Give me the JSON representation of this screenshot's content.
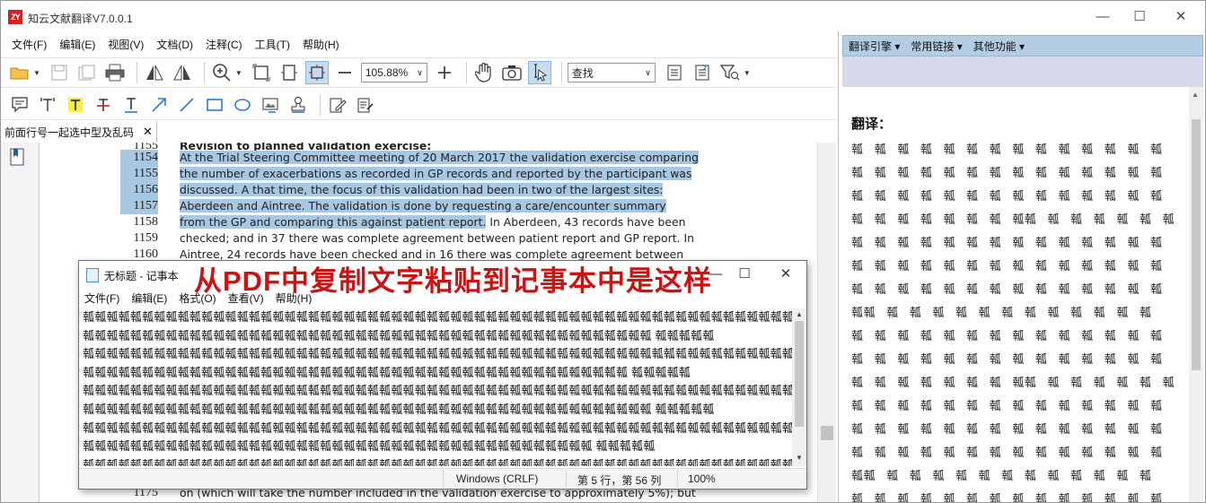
{
  "window": {
    "logo": "ZY",
    "title": "知云文献翻译V7.0.0.1",
    "minimize_label": "—",
    "maximize_label": "☐",
    "close_label": "✕"
  },
  "menu": {
    "items": [
      "文件(F)",
      "编辑(E)",
      "视图(V)",
      "文档(D)",
      "注释(C)",
      "工具(T)",
      "帮助(H)"
    ]
  },
  "toolbar": {
    "zoom_value": "105.88%",
    "search_value": "查找"
  },
  "tab": {
    "label": "前面行号一起选中型及乱码",
    "close_label": "✕"
  },
  "document": {
    "lines": [
      {
        "num": "1155",
        "text": "Revision to planned validation exercise:",
        "highlight": false,
        "bold": true
      },
      {
        "num": "1154",
        "text": "At the Trial Steering Committee meeting of 20 March 2017 the validation exercise comparing",
        "highlight": true
      },
      {
        "num": "1155",
        "text": "the number of exacerbations as recorded in GP records and reported by the participant was",
        "highlight": true
      },
      {
        "num": "1156",
        "text": "discussed. A that time, the focus of this validation had been in two of the largest sites:",
        "highlight": true
      },
      {
        "num": "1157",
        "text": "Aberdeen and Aintree.   The validation is done by requesting a care/encounter summary",
        "highlight": true
      },
      {
        "num": "1158",
        "text": "from the GP and comparing this against patient report.",
        "text_after": " In Aberdeen, 43 records have been",
        "highlight": "partial"
      },
      {
        "num": "1159",
        "text": "checked; and in 37 there was complete agreement between patient report and GP report.  In",
        "highlight": false
      },
      {
        "num": "1160",
        "text": "Aintree, 24 records have been checked and in 16 there was complete agreement between",
        "highlight": false
      }
    ],
    "bottom_line": {
      "num": "1175",
      "text": "on (which will take the number included in the validation exercise to approximately 5%); but"
    }
  },
  "right_panel": {
    "menu": [
      "翻译引擎 ▾",
      "常用链接 ▾",
      "其他功能 ▾"
    ],
    "title": "翻译：",
    "garbled_rows": [
      "瓡 瓡 瓡 瓡 瓡 瓡 瓡 瓡 瓡 瓡 瓡 瓡 瓡 瓡",
      "瓡 瓡 瓡 瓡 瓡 瓡 瓡 瓡 瓡 瓡 瓡 瓡 瓡 瓡",
      "瓡 瓡 瓡 瓡 瓡 瓡 瓡 瓡 瓡 瓡 瓡 瓡 瓡 瓡",
      "瓡 瓡 瓡 瓡 瓡 瓡 瓡 瓡瓡 瓡 瓡 瓡 瓡 瓡 瓡",
      "瓡 瓡 瓡 瓡 瓡 瓡 瓡 瓡 瓡 瓡 瓡 瓡 瓡 瓡",
      "瓡 瓡 瓡 瓡 瓡 瓡 瓡 瓡 瓡 瓡 瓡 瓡 瓡 瓡",
      "瓡 瓡 瓡 瓡 瓡 瓡 瓡 瓡 瓡 瓡 瓡 瓡 瓡 瓡",
      "瓡瓡 瓡 瓡 瓡 瓡 瓡 瓡 瓡 瓡 瓡 瓡 瓡 瓡",
      "瓡 瓡 瓡 瓡 瓡 瓡 瓡 瓡 瓡 瓡 瓡 瓡 瓡 瓡",
      "瓡 瓡 瓡 瓡 瓡 瓡 瓡 瓡 瓡 瓡 瓡 瓡 瓡 瓡",
      "瓡 瓡 瓡 瓡 瓡 瓡 瓡 瓡瓡 瓡 瓡 瓡 瓡 瓡 瓡",
      "瓡 瓡 瓡 瓡 瓡 瓡 瓡 瓡 瓡 瓡 瓡 瓡 瓡 瓡",
      "瓡 瓡 瓡 瓡 瓡 瓡 瓡 瓡 瓡 瓡 瓡 瓡 瓡 瓡",
      "瓡 瓡 瓡 瓡 瓡 瓡 瓡 瓡 瓡 瓡 瓡 瓡 瓡 瓡",
      "瓡瓡 瓡 瓡 瓡 瓡 瓡 瓡 瓡 瓡 瓡 瓡 瓡 瓡",
      "瓡 瓡 瓡 瓡 瓡 瓡 瓡 瓡 瓡 瓡 瓡 瓡 瓡 瓡"
    ]
  },
  "notepad": {
    "title": "无标题 - 记事本",
    "annotation": "从PDF中复制文字粘贴到记事本中是这样",
    "minimize_label": "—",
    "maximize_label": "☐",
    "close_label": "✕",
    "menu": [
      "文件(F)",
      "编辑(E)",
      "格式(O)",
      "查看(V)",
      "帮助(H)"
    ],
    "content_lines": [
      "瓡瓡瓡瓡瓡瓡瓡瓡瓡瓡瓡瓡瓡瓡瓡瓡瓡瓡瓡瓡瓡瓡瓡瓡瓡瓡瓡瓡瓡瓡瓡瓡瓡瓡瓡瓡瓡瓡瓡瓡瓡瓡瓡瓡瓡瓡瓡瓡瓡瓡瓡瓡瓡瓡瓡瓡瓡瓡瓡瓡",
      "瓡瓡瓡瓡瓡瓡瓡瓡瓡瓡瓡瓡瓡瓡瓡瓡瓡瓡瓡瓡瓡瓡瓡瓡瓡瓡瓡瓡瓡瓡瓡瓡瓡瓡瓡瓡瓡瓡瓡瓡瓡瓡瓡瓡瓡瓡瓡瓡 瓡瓡瓡瓡瓡",
      "瓡瓡瓡瓡瓡瓡瓡瓡瓡瓡瓡瓡瓡瓡瓡瓡瓡瓡瓡瓡瓡瓡瓡瓡瓡瓡瓡瓡瓡瓡瓡瓡瓡瓡瓡瓡瓡瓡瓡瓡瓡瓡瓡瓡瓡瓡瓡瓡瓡瓡瓡瓡瓡瓡瓡瓡瓡瓡瓡瓡",
      "瓡瓡瓡瓡瓡瓡瓡瓡瓡瓡瓡瓡瓡瓡瓡瓡瓡瓡瓡瓡瓡瓡瓡瓡瓡瓡瓡瓡瓡瓡瓡瓡瓡瓡瓡瓡瓡瓡瓡瓡瓡瓡瓡瓡瓡瓡 瓡瓡瓡瓡瓡",
      "瓡瓡瓡瓡瓡瓡瓡瓡瓡瓡瓡瓡瓡瓡瓡瓡瓡瓡瓡瓡瓡瓡瓡瓡瓡瓡瓡瓡瓡瓡瓡瓡瓡瓡瓡瓡瓡瓡瓡瓡瓡瓡瓡瓡瓡瓡瓡瓡瓡瓡瓡瓡瓡瓡瓡瓡瓡瓡瓡瓡",
      "瓡瓡瓡瓡瓡瓡瓡瓡瓡瓡瓡瓡瓡瓡瓡瓡瓡瓡瓡瓡瓡瓡瓡瓡瓡瓡瓡瓡瓡瓡瓡瓡瓡瓡瓡瓡瓡瓡瓡瓡瓡瓡瓡瓡瓡瓡瓡瓡 瓡瓡瓡瓡瓡",
      "瓡瓡瓡瓡瓡瓡瓡瓡瓡瓡瓡瓡瓡瓡瓡瓡瓡瓡瓡瓡瓡瓡瓡瓡瓡瓡瓡瓡瓡瓡瓡瓡瓡瓡瓡瓡瓡瓡瓡瓡瓡瓡瓡瓡瓡瓡瓡瓡瓡瓡瓡瓡瓡瓡瓡瓡瓡瓡瓡瓡",
      "瓡瓡瓡瓡瓡瓡瓡瓡瓡瓡瓡瓡瓡瓡瓡瓡瓡瓡瓡瓡瓡瓡瓡瓡瓡瓡瓡瓡瓡瓡瓡瓡瓡瓡瓡瓡瓡瓡瓡瓡瓡瓡瓡 瓡瓡瓡瓡瓡",
      "瓡瓡瓡瓡瓡瓡瓡瓡瓡瓡瓡瓡瓡瓡瓡瓡瓡瓡瓡瓡瓡瓡瓡瓡瓡瓡瓡瓡瓡瓡瓡瓡瓡瓡瓡瓡瓡瓡瓡瓡瓡瓡瓡瓡瓡瓡瓡瓡瓡瓡瓡瓡瓡瓡瓡瓡瓡瓡瓡瓡"
    ],
    "status": {
      "encoding": "Windows (CRLF)",
      "position": "第 5 行，第 56 列",
      "zoom": "100%"
    }
  }
}
